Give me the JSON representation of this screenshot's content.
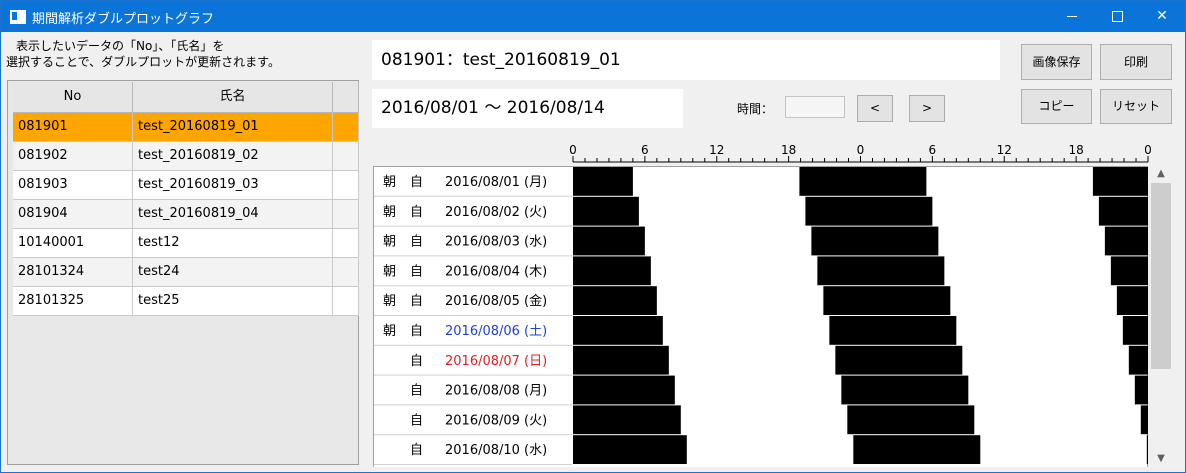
{
  "window": {
    "title": "期間解析ダブルプロットグラフ"
  },
  "instructions": {
    "line1": "表示したいデータの「No」、「氏名」を",
    "line2": "選択することで、ダブルプロットが更新されます。"
  },
  "table": {
    "headers": [
      "No",
      "氏名",
      ""
    ],
    "rows": [
      {
        "no": "081901",
        "name": "test_20160819_01",
        "selected": true
      },
      {
        "no": "081902",
        "name": "test_20160819_02",
        "selected": false
      },
      {
        "no": "081903",
        "name": "test_20160819_03",
        "selected": false
      },
      {
        "no": "081904",
        "name": "test_20160819_04",
        "selected": false
      },
      {
        "no": "10140001",
        "name": "test12",
        "selected": false
      },
      {
        "no": "28101324",
        "name": "test24",
        "selected": false
      },
      {
        "no": "28101325",
        "name": "test25",
        "selected": false
      }
    ]
  },
  "header": {
    "subject": "081901：test_20160819_01",
    "period": "2016/08/01 〜 2016/08/14",
    "time_label": "時間：",
    "time_value": "",
    "prev_label": "<",
    "next_label": ">"
  },
  "buttons": {
    "save": "画像保存",
    "print": "印刷",
    "copy": "コピー",
    "reset": "リセット"
  },
  "colors": {
    "selected_row": "#ffa500",
    "titlebar": "#0a74d8",
    "saturday": "#1f3fd0",
    "sunday": "#e02020",
    "sleep": "#000000",
    "awake": "#ffffff"
  },
  "chart_data": {
    "type": "double-plot actogram",
    "axis": {
      "ticks": [
        "0",
        "6",
        "12",
        "18",
        "0",
        "6",
        "12",
        "18",
        "0"
      ],
      "range_hours": [
        0,
        48
      ]
    },
    "sleep_color": "#000000",
    "days": [
      {
        "morning": "朝",
        "self": "自",
        "date": "2016/08/01 (月)",
        "color": "normal",
        "sleep": [
          [
            0,
            5.0
          ],
          [
            18.9,
            24
          ]
        ]
      },
      {
        "morning": "朝",
        "self": "自",
        "date": "2016/08/02 (火)",
        "color": "normal",
        "sleep": [
          [
            0,
            5.5
          ],
          [
            19.4,
            24
          ]
        ]
      },
      {
        "morning": "朝",
        "self": "自",
        "date": "2016/08/03 (水)",
        "color": "normal",
        "sleep": [
          [
            0,
            6.0
          ],
          [
            19.9,
            24
          ]
        ]
      },
      {
        "morning": "朝",
        "self": "自",
        "date": "2016/08/04 (木)",
        "color": "normal",
        "sleep": [
          [
            0,
            6.5
          ],
          [
            20.4,
            24
          ]
        ]
      },
      {
        "morning": "朝",
        "self": "自",
        "date": "2016/08/05 (金)",
        "color": "normal",
        "sleep": [
          [
            0,
            7.0
          ],
          [
            20.9,
            24
          ]
        ]
      },
      {
        "morning": "朝",
        "self": "自",
        "date": "2016/08/06 (土)",
        "color": "saturday",
        "sleep": [
          [
            0,
            7.5
          ],
          [
            21.4,
            24
          ]
        ]
      },
      {
        "morning": "",
        "self": "自",
        "date": "2016/08/07 (日)",
        "color": "sunday",
        "sleep": [
          [
            0,
            8.0
          ],
          [
            21.9,
            24
          ]
        ]
      },
      {
        "morning": "",
        "self": "自",
        "date": "2016/08/08 (月)",
        "color": "normal",
        "sleep": [
          [
            0,
            8.5
          ],
          [
            22.4,
            24
          ]
        ]
      },
      {
        "morning": "",
        "self": "自",
        "date": "2016/08/09 (火)",
        "color": "normal",
        "sleep": [
          [
            0,
            9.0
          ],
          [
            22.9,
            24
          ]
        ]
      },
      {
        "morning": "",
        "self": "自",
        "date": "2016/08/10 (水)",
        "color": "normal",
        "sleep": [
          [
            0,
            9.5
          ],
          [
            23.4,
            24
          ]
        ]
      }
    ]
  }
}
